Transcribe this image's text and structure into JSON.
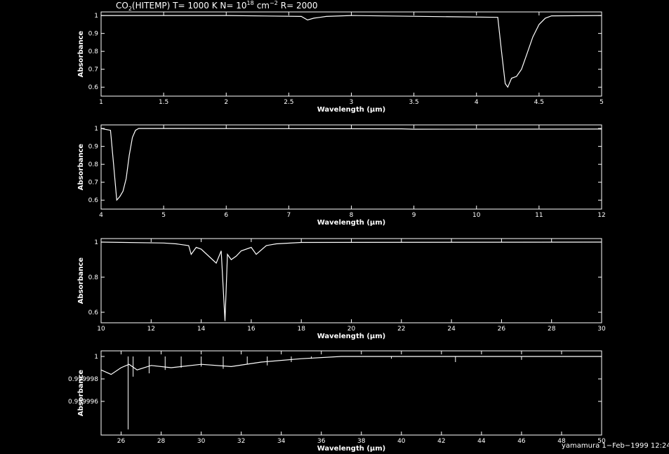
{
  "title": {
    "prefix": "CO",
    "sub": "2",
    "mid": "(HITEMP) T= 1000 K N= 10",
    "sup": "18",
    "unit": "cm",
    "unit_sup": "−2",
    "suffix": "R= 2000"
  },
  "footer": "yamamura  1−Feb−1999 12:24",
  "chart_data": [
    {
      "type": "line",
      "xlabel": "Wavelength (μm)",
      "ylabel": "Absorbance",
      "xlim": [
        1,
        5
      ],
      "ylim": [
        0.55,
        1.02
      ],
      "xticks": [
        1,
        1.5,
        2,
        2.5,
        3,
        3.5,
        4,
        4.5,
        5
      ],
      "xtick_labels": [
        "1",
        "1.5",
        "2",
        "2.5",
        "3",
        "3.5",
        "4",
        "4.5",
        "5"
      ],
      "yticks": [
        0.6,
        0.7,
        0.8,
        0.9,
        1
      ],
      "ytick_labels": [
        "0.6",
        "0.7",
        "0.8",
        "0.9",
        "1"
      ],
      "x": [
        1.0,
        2.0,
        2.6,
        2.65,
        2.7,
        2.75,
        2.8,
        3.0,
        4.17,
        4.2,
        4.23,
        4.25,
        4.28,
        4.32,
        4.36,
        4.4,
        4.45,
        4.5,
        4.55,
        4.6,
        5.0
      ],
      "y": [
        1.0,
        1.0,
        0.995,
        0.975,
        0.985,
        0.99,
        0.995,
        1.0,
        0.99,
        0.8,
        0.62,
        0.6,
        0.65,
        0.66,
        0.7,
        0.78,
        0.88,
        0.95,
        0.985,
        0.998,
        1.0
      ]
    },
    {
      "type": "line",
      "xlabel": "Wavelength (μm)",
      "ylabel": "Absorbance",
      "xlim": [
        4,
        12
      ],
      "ylim": [
        0.55,
        1.02
      ],
      "xticks": [
        4,
        5,
        6,
        7,
        8,
        9,
        10,
        11,
        12
      ],
      "xtick_labels": [
        "4",
        "5",
        "6",
        "7",
        "8",
        "9",
        "10",
        "11",
        "12"
      ],
      "yticks": [
        0.6,
        0.7,
        0.8,
        0.9,
        1
      ],
      "ytick_labels": [
        "0.6",
        "0.7",
        "0.8",
        "0.9",
        "1"
      ],
      "x": [
        4.0,
        4.15,
        4.2,
        4.25,
        4.3,
        4.35,
        4.4,
        4.45,
        4.5,
        4.55,
        4.6,
        5.0,
        8.8,
        9.0,
        12.0
      ],
      "y": [
        1.0,
        0.99,
        0.8,
        0.6,
        0.62,
        0.65,
        0.72,
        0.85,
        0.95,
        0.99,
        1.0,
        1.0,
        0.998,
        0.996,
        0.997
      ]
    },
    {
      "type": "line",
      "xlabel": "Wavelength (μm)",
      "ylabel": "Absorbance",
      "xlim": [
        10,
        30
      ],
      "ylim": [
        0.54,
        1.02
      ],
      "xticks": [
        10,
        12,
        14,
        16,
        18,
        20,
        22,
        24,
        26,
        28,
        30
      ],
      "xtick_labels": [
        "10",
        "12",
        "14",
        "16",
        "18",
        "20",
        "22",
        "24",
        "26",
        "28",
        "30"
      ],
      "yticks": [
        0.6,
        0.8,
        1
      ],
      "ytick_labels": [
        "0.6",
        "0.8",
        "1"
      ],
      "x": [
        10.0,
        12.5,
        13.0,
        13.5,
        13.6,
        13.8,
        14.0,
        14.3,
        14.6,
        14.8,
        14.95,
        15.05,
        15.2,
        15.4,
        15.6,
        16.0,
        16.2,
        16.6,
        17.0,
        18.0,
        30.0
      ],
      "y": [
        1.0,
        0.995,
        0.99,
        0.98,
        0.93,
        0.97,
        0.96,
        0.92,
        0.88,
        0.95,
        0.55,
        0.93,
        0.9,
        0.92,
        0.95,
        0.97,
        0.93,
        0.98,
        0.99,
        0.998,
        1.0
      ]
    },
    {
      "type": "line",
      "xlabel": "Wavelength (μm)",
      "ylabel": "Absorbance",
      "xlim": [
        25,
        50
      ],
      "ylim": [
        0.999993,
        1.0000005
      ],
      "xticks": [
        26,
        28,
        30,
        32,
        34,
        36,
        38,
        40,
        42,
        44,
        46,
        48,
        50
      ],
      "xtick_labels": [
        "26",
        "28",
        "30",
        "32",
        "34",
        "36",
        "38",
        "40",
        "42",
        "44",
        "46",
        "48",
        "50"
      ],
      "yticks": [
        0.999996,
        0.999998,
        1
      ],
      "ytick_labels": [
        "0.999996",
        "0.999998",
        "1"
      ],
      "x": [
        25.0,
        25.5,
        26.0,
        26.4,
        26.8,
        27.5,
        28.5,
        30.0,
        31.5,
        33.0,
        35.0,
        37.0,
        40.0,
        50.0
      ],
      "y": [
        0.9999988,
        0.9999984,
        0.999999,
        0.9999993,
        0.9999988,
        0.9999992,
        0.999999,
        0.9999993,
        0.9999991,
        0.9999995,
        0.9999998,
        1.0,
        1.0,
        1.0
      ],
      "spikes": [
        {
          "x": 26.35,
          "y": 0.9999935
        },
        {
          "x": 26.6,
          "y": 0.9999982
        },
        {
          "x": 27.4,
          "y": 0.9999985
        },
        {
          "x": 28.2,
          "y": 0.9999988
        },
        {
          "x": 29.0,
          "y": 0.999999
        },
        {
          "x": 30.0,
          "y": 0.9999991
        },
        {
          "x": 31.1,
          "y": 0.9999989
        },
        {
          "x": 32.3,
          "y": 0.9999993
        },
        {
          "x": 33.3,
          "y": 0.9999992
        },
        {
          "x": 34.5,
          "y": 0.9999995
        },
        {
          "x": 35.5,
          "y": 0.9999998
        },
        {
          "x": 39.5,
          "y": 0.9999998
        },
        {
          "x": 42.7,
          "y": 0.9999995
        },
        {
          "x": 46.0,
          "y": 0.9999997
        }
      ]
    }
  ]
}
